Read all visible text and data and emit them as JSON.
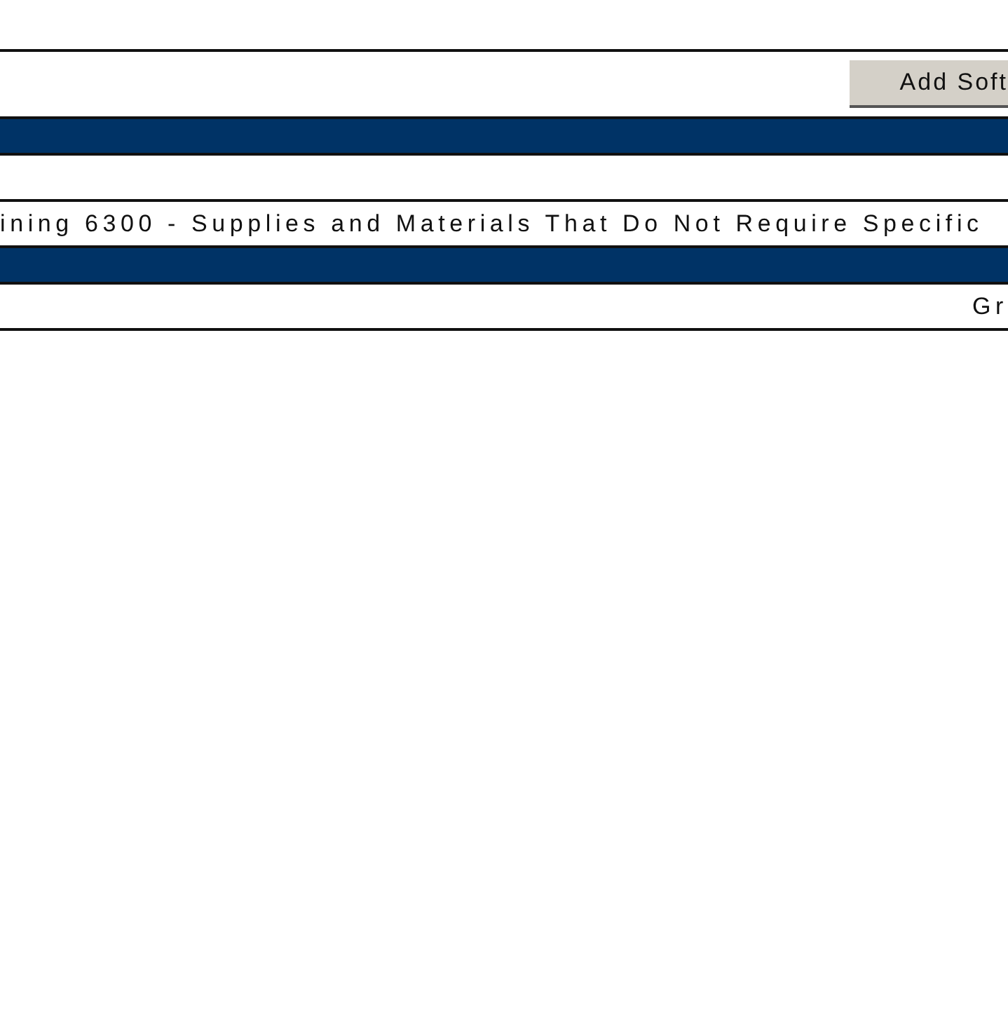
{
  "toolbar": {
    "button": "Add Soft"
  },
  "rows": [
    {
      "kind": "blank"
    },
    {
      "kind": "label",
      "text": "ining 6300 - Supplies and Materials That Do Not Require Specific"
    },
    {
      "kind": "bar"
    },
    {
      "kind": "total",
      "text": "Gr"
    }
  ]
}
